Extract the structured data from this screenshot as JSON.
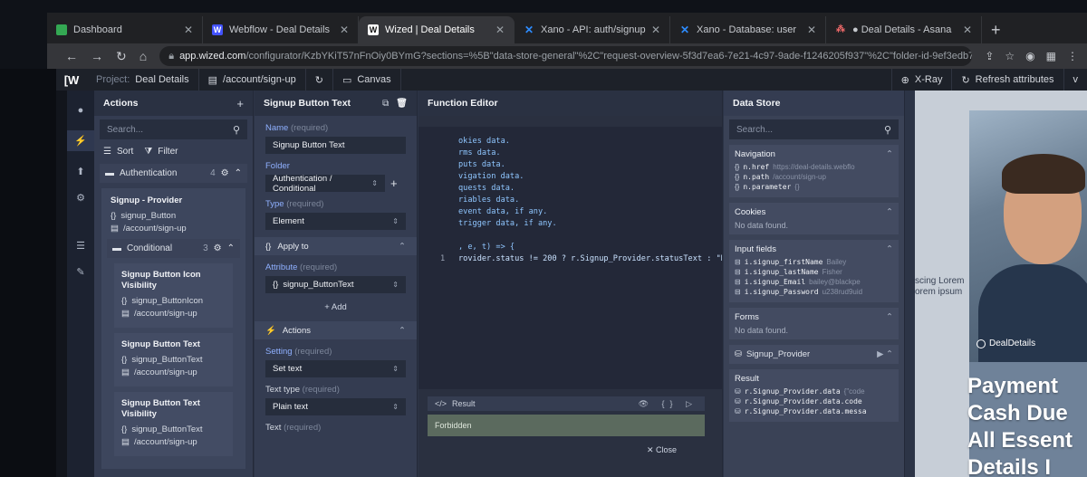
{
  "browser": {
    "tabs": [
      {
        "label": "Dashboard",
        "icon": "#34a853",
        "active": false
      },
      {
        "label": "Webflow - Deal Details",
        "icon": "#4353ff",
        "active": false
      },
      {
        "label": "Wized | Deal Details",
        "icon": "#ffffff",
        "active": true
      },
      {
        "label": "Xano - API: auth/signup",
        "icon": "#2d8cff",
        "active": false
      },
      {
        "label": "Xano - Database: user",
        "icon": "#2d8cff",
        "active": false
      },
      {
        "label": "● Deal Details - Asana",
        "icon": "#f06a6a",
        "active": false
      }
    ],
    "new_tab": "+",
    "url_host": "app.wized.com",
    "url_path": "/configurator/KzbYKiT57nFnOiy0BYmG?sections=%5B\"data-store-general\"%2C\"request-overview-5f3d7ea6-7e21-4c97-9ade-f1246205f937\"%2C\"folder-id-9ef3edb7-21fd-484f-8166-0a2..."
  },
  "topbar": {
    "logo": "[W",
    "project_label": "Project:",
    "project_name": "Deal Details",
    "page": "/account/sign-up",
    "canvas": "Canvas",
    "xray": "X-Ray",
    "refresh": "Refresh attributes",
    "version": "v"
  },
  "actions": {
    "title": "Actions",
    "search_placeholder": "Search...",
    "sort": "Sort",
    "filter": "Filter",
    "groups": [
      {
        "label": "Authentication",
        "count": "4"
      }
    ],
    "card": {
      "title": "Signup - Provider",
      "element": "signup_Button",
      "page": "/account/sign-up"
    },
    "subgroup": {
      "label": "Conditional",
      "count": "3"
    },
    "items": [
      {
        "title": "Signup Button Icon Visibility",
        "element": "signup_ButtonIcon",
        "page": "/account/sign-up"
      },
      {
        "title": "Signup Button Text",
        "element": "signup_ButtonText",
        "page": "/account/sign-up"
      },
      {
        "title": "Signup Button Text Visibility",
        "element": "signup_ButtonText",
        "page": "/account/sign-up"
      }
    ]
  },
  "setting": {
    "title": "Signup Button Text",
    "name_label": "Name",
    "name_hint": "(required)",
    "name_value": "Signup Button Text",
    "folder_label": "Folder",
    "folder_value": "Authentication / Conditional",
    "type_label": "Type",
    "type_hint": "(required)",
    "type_value": "Element",
    "apply_to": "Apply to",
    "attribute_label": "Attribute",
    "attribute_hint": "(required)",
    "attribute_value": "signup_ButtonText",
    "add": "+ Add",
    "actions": "Actions",
    "setting_label": "Setting",
    "setting_hint": "(required)",
    "setting_value": "Set text",
    "text_type_label": "Text type",
    "text_type_hint": "(required)",
    "text_type_value": "Plain text",
    "text_label": "Text",
    "text_hint": "(required)"
  },
  "editor": {
    "title": "Function Editor",
    "comment_lines": [
      "okies data.",
      "rms data.",
      "puts data.",
      "vigation data.",
      "quests data.",
      "riables data.",
      "event data, if any.",
      "trigger data, if any."
    ],
    "arrow_line": ", e, t) => {",
    "line_no": "1",
    "code_line": "rovider.status != 200 ? r.Signup_Provider.statusText : \"N",
    "result_label": "Result",
    "result_icons": "👁 {}  ▷",
    "result_value": "Forbidden",
    "close": "Close"
  },
  "store": {
    "title": "Data Store",
    "search_placeholder": "Search...",
    "navigation": {
      "title": "Navigation",
      "rows": [
        {
          "key": "n.href",
          "value": "https://deal-details.webflo"
        },
        {
          "key": "n.path",
          "value": "/account/sign-up"
        },
        {
          "key": "n.parameter",
          "value": "{}"
        }
      ]
    },
    "cookies": {
      "title": "Cookies",
      "empty": "No data found."
    },
    "inputs": {
      "title": "Input fields",
      "rows": [
        {
          "key": "i.signup_firstName",
          "value": "Bailey"
        },
        {
          "key": "i.signup_lastName",
          "value": "Fisher"
        },
        {
          "key": "i.signup_Email",
          "value": "bailey@blackpe"
        },
        {
          "key": "i.signup_Password",
          "value": "u238rud9uid"
        }
      ]
    },
    "forms": {
      "title": "Forms",
      "empty": "No data found."
    },
    "provider": "Signup_Provider",
    "result_title": "Result",
    "result_rows": [
      {
        "key": "r.Signup_Provider.data",
        "value": "{\"code"
      },
      {
        "key": "r.Signup_Provider.data.code",
        "value": ""
      },
      {
        "key": "r.Signup_Provider.data.messa",
        "value": ""
      }
    ]
  },
  "preview": {
    "lorem1": "scing Lorem",
    "lorem2": "orem ipsum",
    "brand": "DealDetails",
    "headline1": "Payment",
    "headline2": "Cash Due",
    "headline3": "All Essent",
    "headline4": "Details I"
  }
}
